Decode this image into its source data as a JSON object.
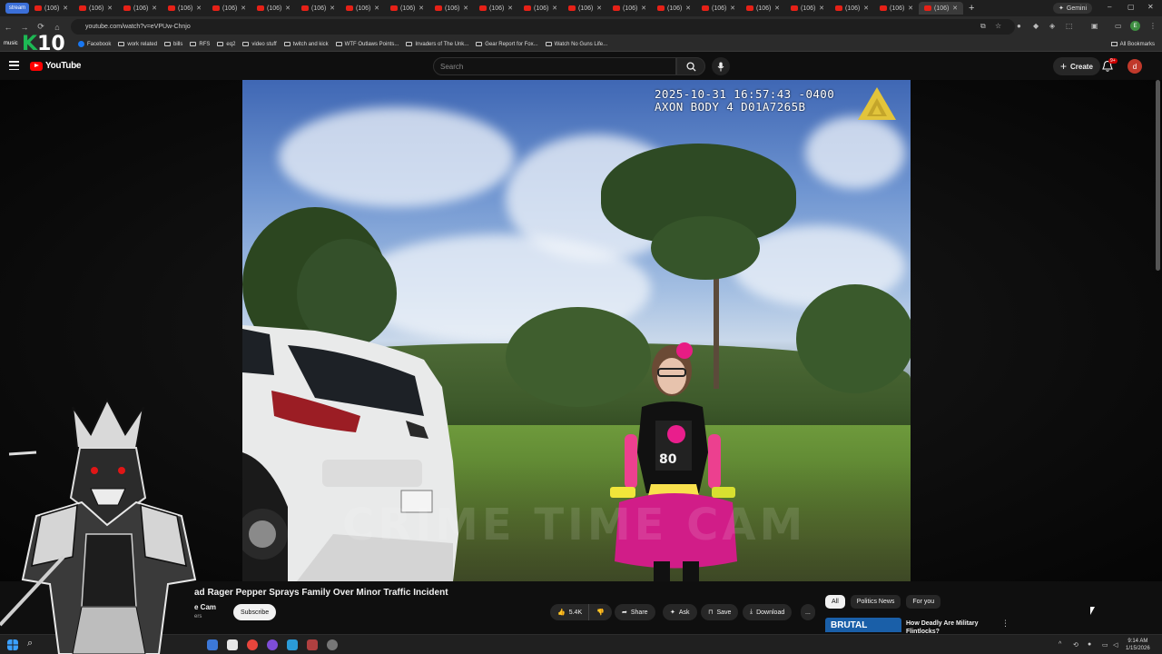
{
  "browser": {
    "first_tab_label": "stream",
    "tab_label": "(106)",
    "new_tab": "+",
    "gemini_label": "Gemini",
    "url": "youtube.com/watch?v=eVPUw-Chnjo",
    "bookmarks": [
      "Facebook",
      "work related",
      "bills",
      "RFS",
      "eq2",
      "video stuff",
      "twitch and kick",
      "WTF Outlaws Points...",
      "Invaders of The Unk...",
      "Gear Report for Fox...",
      "Watch No Guns Life..."
    ],
    "all_bookmarks": "All Bookmarks"
  },
  "overlay": {
    "music_label": "music",
    "logo_letter": "K",
    "logo_number": "10"
  },
  "youtube": {
    "logo_text": "YouTube",
    "search_placeholder": "Search",
    "create_label": "Create",
    "notif_badge": "9+",
    "avatar_letter": "d"
  },
  "video": {
    "timestamp_line1": "2025-10-31 16:57:43 -0400",
    "timestamp_line2": "AXON BODY 4 D01A7265B",
    "watermark": "CRIME TIME CAM",
    "title": "ad Rager Pepper Sprays Family Over Minor Traffic Incident",
    "channel": "e Cam",
    "channel_sub": "ers",
    "subscribe": "Subscribe",
    "actions": {
      "likes": "5.4K",
      "share": "Share",
      "ask": "Ask",
      "save": "Save",
      "download": "Download",
      "more": "..."
    }
  },
  "sidebar": {
    "chips": [
      "All",
      "Politics News",
      "For you"
    ],
    "rec_thumb_text": "BRUTAL",
    "rec_title": "How Deadly Are Military Flintlocks?",
    "rec_more": "⋮"
  },
  "taskbar": {
    "time": "9:14 AM",
    "date": "1/15/2026"
  },
  "colors": {
    "yt_red": "#ff0000",
    "background": "#0f0f0f",
    "logo_green": "#1db954"
  }
}
